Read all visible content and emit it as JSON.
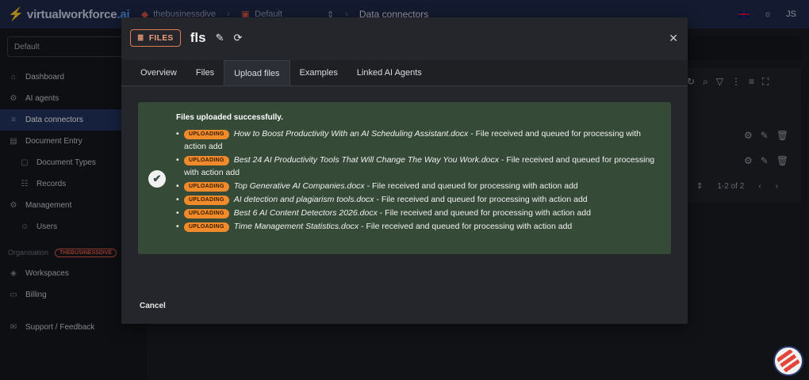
{
  "app": {
    "logo_text": "virtualworkforce",
    "logo_suffix": ".ai"
  },
  "topbar": {
    "breadcrumbs": [
      "thebusinessdive",
      "Default",
      "Data connectors"
    ],
    "user_initials": "JS"
  },
  "sidebar": {
    "workspace_select": "Default",
    "items": [
      {
        "label": "Dashboard",
        "icon": "home-icon"
      },
      {
        "label": "AI agents",
        "icon": "agents-icon"
      },
      {
        "label": "Data connectors",
        "icon": "database-icon",
        "active": true
      },
      {
        "label": "Document Entry",
        "icon": "document-icon"
      },
      {
        "label": "Document Types",
        "icon": "doc-types-icon"
      },
      {
        "label": "Records",
        "icon": "records-icon"
      },
      {
        "label": "Management",
        "icon": "gear-icon"
      },
      {
        "label": "Users",
        "icon": "users-icon"
      }
    ],
    "org_label": "Organisation",
    "org_badge": "THEBUSINESSDIVE",
    "org_items": [
      {
        "label": "Workspaces",
        "icon": "layers-icon"
      },
      {
        "label": "Billing",
        "icon": "billing-icon"
      }
    ],
    "support_label": "Support / Feedback"
  },
  "background": {
    "pager_text": "1-2 of 2"
  },
  "modal": {
    "tag_label": "FILES",
    "title": "fls",
    "tabs": [
      "Overview",
      "Files",
      "Upload files",
      "Examples",
      "Linked AI Agents"
    ],
    "active_tab": "Upload files",
    "alert_title": "Files uploaded successfully.",
    "badge_label": "UPLOADING",
    "files": [
      {
        "name": "How to Boost Productivity With an AI Scheduling Assistant.docx",
        "message": " - File received and queued for processing with action add"
      },
      {
        "name": "Best 24 AI Productivity Tools That Will Change The Way You Work.docx",
        "message": " - File received and queued for processing with action add"
      },
      {
        "name": "Top Generative AI Companies.docx",
        "message": " - File received and queued for processing with action add"
      },
      {
        "name": "AI detection and plagiarism tools.docx",
        "message": " - File received and queued for processing with action add"
      },
      {
        "name": "Best 6 AI Content Detectors 2026.docx",
        "message": " - File received and queued for processing with action add"
      },
      {
        "name": "Time Management Statistics.docx",
        "message": " - File received and queued for processing with action add"
      }
    ],
    "cancel_label": "Cancel"
  },
  "colors": {
    "accent": "#233360",
    "success_bg": "#364a38",
    "badge": "#f08a2a",
    "brand_red": "#e25a4a"
  }
}
